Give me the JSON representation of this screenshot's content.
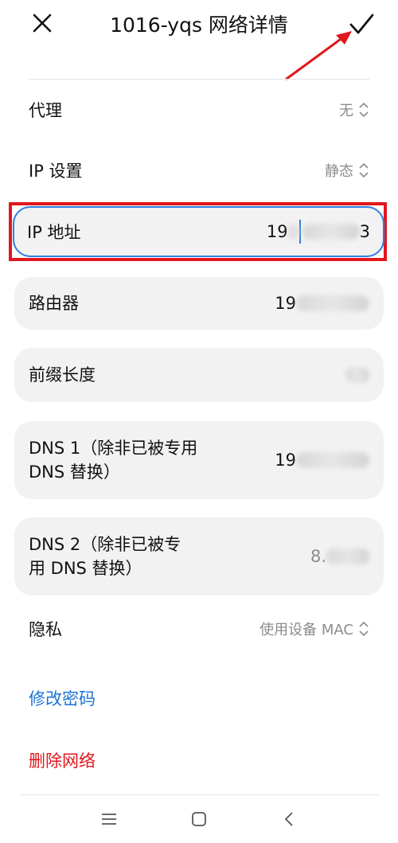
{
  "header": {
    "title": "1016-yqs 网络详情",
    "close_icon": "close-icon",
    "confirm_icon": "check-icon"
  },
  "settings": {
    "proxy": {
      "label": "代理",
      "value": "无"
    },
    "ip_settings": {
      "label": "IP 设置",
      "value": "静态"
    },
    "ip_address": {
      "label": "IP 地址",
      "value_prefix": "19",
      "value_suffix": "3"
    },
    "router": {
      "label": "路由器",
      "value_prefix": "19"
    },
    "prefix_length": {
      "label": "前缀长度"
    },
    "dns1": {
      "label_line1": "DNS 1（除非已被专用",
      "label_line2": "DNS 替换）",
      "value_prefix": "19"
    },
    "dns2": {
      "label_line1": "DNS 2（除非已被专",
      "label_line2": "用 DNS 替换）",
      "value_prefix": "8."
    },
    "privacy": {
      "label": "隐私",
      "value": "使用设备 MAC"
    }
  },
  "actions": {
    "modify_password": "修改密码",
    "delete_network": "删除网络"
  },
  "colors": {
    "accent_blue": "#1a73d9",
    "danger_red": "#e0171d",
    "card_bg": "#f2f2f2"
  },
  "navbar": {
    "menu_icon": "menu-icon",
    "home_icon": "home-icon",
    "back_icon": "back-icon"
  }
}
